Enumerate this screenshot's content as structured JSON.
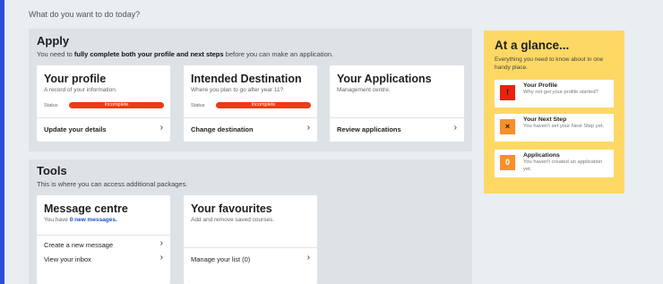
{
  "question": "What do you want to do today?",
  "apply": {
    "title": "Apply",
    "subtitle_pre": "You need to ",
    "subtitle_bold": "fully complete both your profile and next steps",
    "subtitle_post": " before you can make an application.",
    "cards": [
      {
        "title": "Your profile",
        "subtitle": "A record of your information.",
        "status_label": "Status",
        "status": "Incomplete",
        "link": "Update your details"
      },
      {
        "title": "Intended Destination",
        "subtitle": "Where you plan to go after year 11?",
        "status_label": "Status",
        "status": "Incomplete",
        "link": "Change destination"
      },
      {
        "title": "Your Applications",
        "subtitle": "Management centre.",
        "link": "Review applications"
      }
    ]
  },
  "tools": {
    "title": "Tools",
    "subtitle": "This is where you can access additional packages.",
    "message_centre": {
      "title": "Message centre",
      "subtitle_pre": "You have ",
      "subtitle_link": "0 new messages.",
      "links": [
        "Create a new message",
        "View your inbox"
      ]
    },
    "favourites": {
      "title": "Your favourites",
      "subtitle": "Add and remove saved courses.",
      "link": "Manage your list (0)"
    }
  },
  "glance": {
    "title": "At a glance...",
    "subtitle": "Everything you need to know about in one handy place.",
    "items": [
      {
        "badge": "!",
        "title": "Your Profile",
        "text": "Why not get your profile started?",
        "badge_bg": "#e8220f",
        "badge_fg": "#1a1a1a"
      },
      {
        "badge": "×",
        "title": "Your Next Step",
        "text": "You haven't set your Next Step yet.",
        "badge_bg": "#f7902a",
        "badge_fg": "#1a1a1a"
      },
      {
        "badge": "0",
        "title": "Applications",
        "text": "You haven't created an application yet.",
        "badge_bg": "#f7902a",
        "badge_fg": "#ffffff"
      }
    ]
  },
  "colors": {
    "accent_strip": "#2e4fd8",
    "status_incomplete": "#ef3a14",
    "glance_bg": "#fed864",
    "message_link": "#1b4fc4"
  }
}
